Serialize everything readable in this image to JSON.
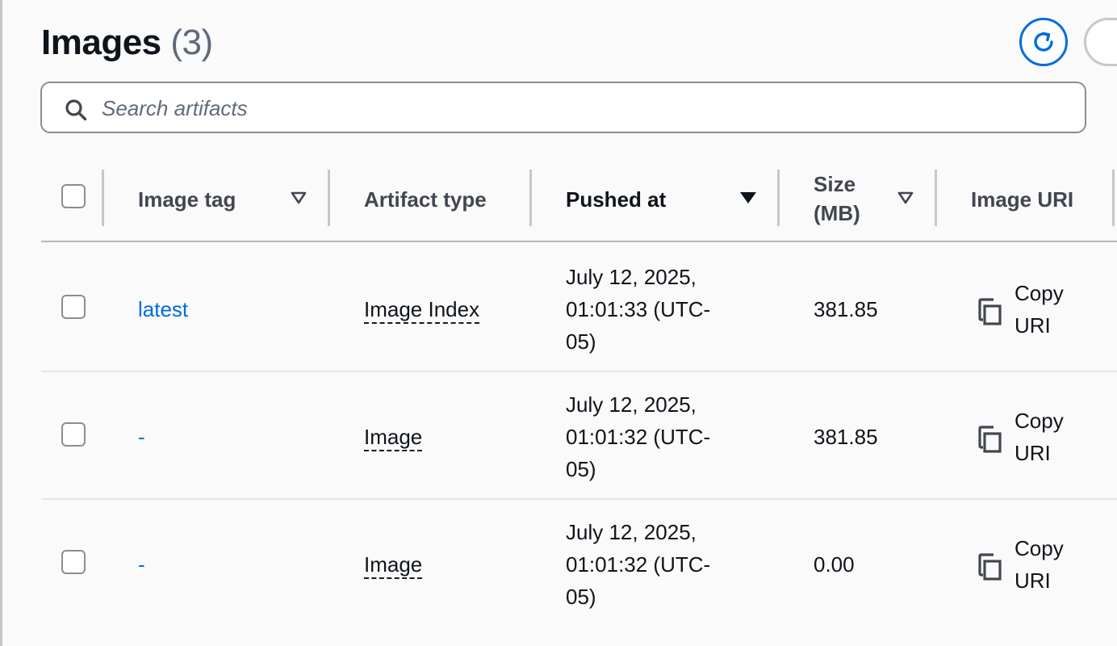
{
  "header": {
    "title": "Images",
    "count": "(3)",
    "refresh_icon": "refresh-icon"
  },
  "search": {
    "placeholder": "Search artifacts",
    "value": ""
  },
  "table": {
    "columns": {
      "image_tag": "Image tag",
      "artifact_type": "Artifact type",
      "pushed_at": "Pushed at",
      "size": "Size (MB)",
      "image_uri": "Image URI"
    },
    "sorted_column": "pushed_at",
    "sort_direction": "descending",
    "rows": [
      {
        "tag": "latest",
        "type": "Image Index",
        "pushed_at": "July 12, 2025, 01:01:33 (UTC-05)",
        "size": "381.85",
        "copy_label": "Copy URI",
        "selected": false
      },
      {
        "tag": "-",
        "type": "Image",
        "pushed_at": "July 12, 2025, 01:01:32 (UTC-05)",
        "size": "381.85",
        "copy_label": "Copy URI",
        "selected": false
      },
      {
        "tag": "-",
        "type": "Image",
        "pushed_at": "July 12, 2025, 01:01:32 (UTC-05)",
        "size": "0.00",
        "copy_label": "Copy URI",
        "selected": false
      }
    ]
  },
  "colors": {
    "accent": "#006ce0",
    "text": "#0f141a",
    "muted": "#5f6b7a",
    "border": "#8c8c94"
  }
}
